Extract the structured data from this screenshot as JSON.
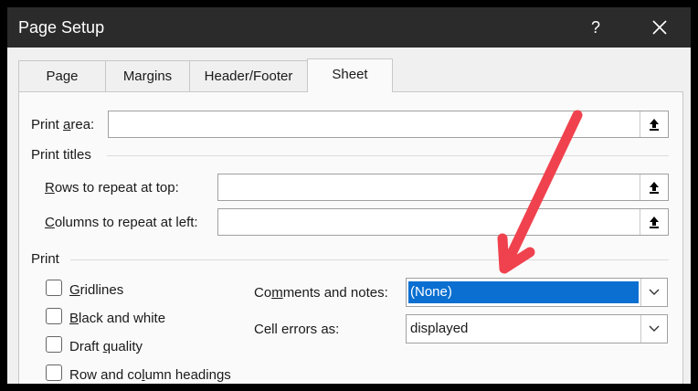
{
  "window": {
    "title": "Page Setup",
    "help_glyph": "?",
    "close_glyph": "✕"
  },
  "tabs": [
    {
      "label": "Page"
    },
    {
      "label": "Margins"
    },
    {
      "label": "Header/Footer"
    },
    {
      "label": "Sheet",
      "active": true
    }
  ],
  "print_area": {
    "label_pre": "Print ",
    "label_u": "a",
    "label_post": "rea:",
    "value": ""
  },
  "print_titles": {
    "heading": "Print titles",
    "rows_label_u": "R",
    "rows_label_post": "ows to repeat at top:",
    "rows_value": "",
    "cols_label_u": "C",
    "cols_label_post": "olumns to repeat at left:",
    "cols_value": ""
  },
  "print": {
    "heading": "Print",
    "gridlines_u": "G",
    "gridlines_post": "ridlines",
    "bw_u": "B",
    "bw_post": "lack and white",
    "draft_pre": "Draft ",
    "draft_u": "q",
    "draft_post": "uality",
    "rowcol_pre": "Row and co",
    "rowcol_u": "l",
    "rowcol_post": "umn headings",
    "comments_pre": "Co",
    "comments_u": "m",
    "comments_post": "ments and notes:",
    "comments_value": "(None)",
    "errors_label": "Cell errors as:",
    "errors_value": "displayed"
  },
  "colors": {
    "titlebar": "#2b2b2b",
    "selection": "#0a6fd1",
    "annotation_arrow": "#f0424e"
  }
}
